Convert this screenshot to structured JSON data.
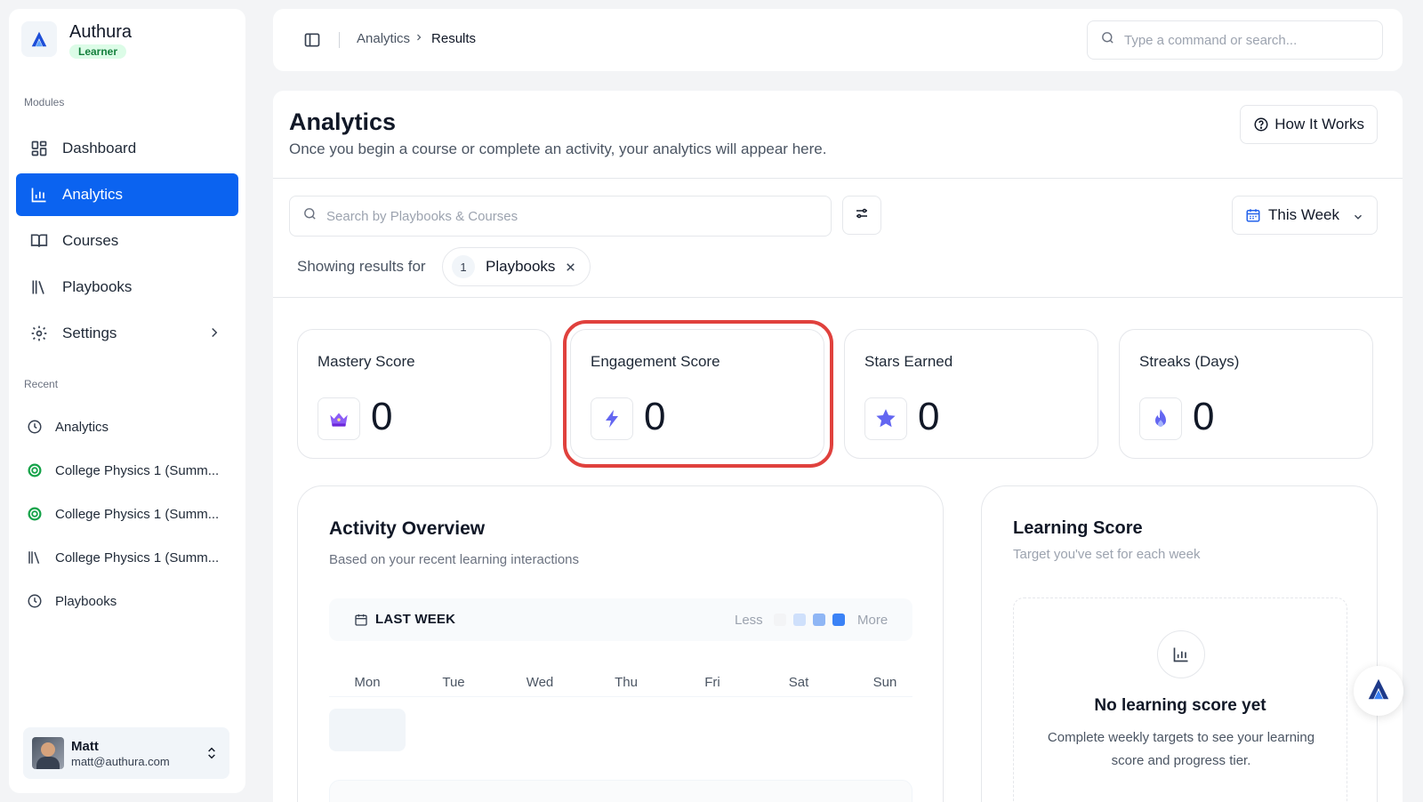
{
  "brand": {
    "name": "Authura",
    "badge": "Learner"
  },
  "sidebar": {
    "modules_label": "Modules",
    "items": [
      {
        "label": "Dashboard",
        "icon": "dashboard-icon"
      },
      {
        "label": "Analytics",
        "icon": "bar-chart-icon",
        "active": true
      },
      {
        "label": "Courses",
        "icon": "book-open-icon"
      },
      {
        "label": "Playbooks",
        "icon": "library-icon"
      },
      {
        "label": "Settings",
        "icon": "gear-icon"
      }
    ],
    "recent_label": "Recent",
    "recent": [
      {
        "label": "Analytics",
        "icon": "clock-icon"
      },
      {
        "label": "College Physics 1 (Summ...",
        "icon": "target-icon"
      },
      {
        "label": "College Physics 1 (Summ...",
        "icon": "target-icon"
      },
      {
        "label": "College Physics 1 (Summ...",
        "icon": "library-icon"
      },
      {
        "label": "Playbooks",
        "icon": "clock-icon"
      }
    ]
  },
  "user": {
    "name": "Matt",
    "email": "matt@authura.com"
  },
  "header": {
    "breadcrumb": [
      "Analytics",
      "Results"
    ],
    "search_placeholder": "Type a command or search..."
  },
  "page": {
    "title": "Analytics",
    "subtitle": "Once you begin a course or complete an activity, your analytics will appear here.",
    "how_it_works": "How It Works",
    "search_placeholder": "Search by Playbooks & Courses",
    "period": "This Week",
    "showing_label": "Showing results for",
    "filter_chip": {
      "count": "1",
      "label": "Playbooks"
    }
  },
  "stats": [
    {
      "label": "Mastery Score",
      "value": "0",
      "icon": "crown-icon"
    },
    {
      "label": "Engagement Score",
      "value": "0",
      "icon": "lightning-icon"
    },
    {
      "label": "Stars Earned",
      "value": "0",
      "icon": "star-icon"
    },
    {
      "label": "Streaks (Days)",
      "value": "0",
      "icon": "flame-icon"
    }
  ],
  "activity": {
    "title": "Activity Overview",
    "subtitle": "Based on your recent learning interactions",
    "range_label": "LAST WEEK",
    "legend_less": "Less",
    "legend_more": "More",
    "legend_colors": [
      "#f3f4f6",
      "#cfe0fb",
      "#8fb6f5",
      "#3b82f6"
    ],
    "days": [
      "Mon",
      "Tue",
      "Wed",
      "Thu",
      "Fri",
      "Sat",
      "Sun"
    ]
  },
  "learning": {
    "title": "Learning Score",
    "subtitle": "Target you've set for each week",
    "empty_title": "No learning score yet",
    "empty_desc": "Complete weekly targets to see your learning score and progress tier."
  },
  "colors": {
    "accent": "#0b63f0",
    "highlight": "#e0413d",
    "badge_bg": "#dcfce7",
    "badge_text": "#15803d"
  }
}
